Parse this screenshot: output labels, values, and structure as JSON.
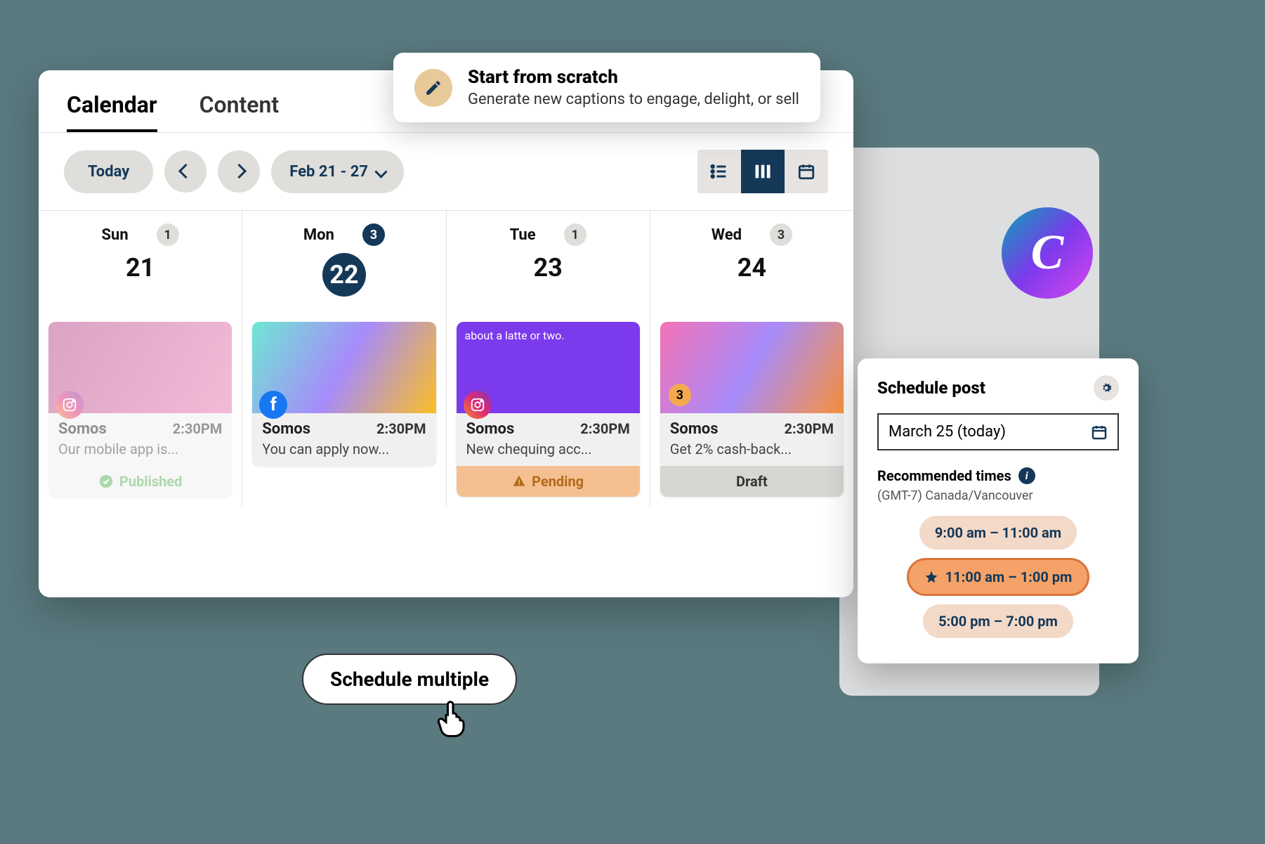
{
  "tabs": {
    "calendar": "Calendar",
    "content": "Content"
  },
  "toolbar": {
    "today": "Today",
    "range": "Feb 21 - 27"
  },
  "days": [
    {
      "name": "Sun",
      "num": "21",
      "count": "1",
      "highlight": false
    },
    {
      "name": "Mon",
      "num": "22",
      "count": "3",
      "highlight": true
    },
    {
      "name": "Tue",
      "num": "23",
      "count": "1",
      "highlight": false
    },
    {
      "name": "Wed",
      "num": "24",
      "count": "3",
      "highlight": false
    }
  ],
  "posts": [
    {
      "account": "Somos",
      "time": "2:30PM",
      "text": "Our mobile app is...",
      "status": "Published",
      "platform": "instagram"
    },
    {
      "account": "Somos",
      "time": "2:30PM",
      "text": "You can apply now...",
      "platform": "facebook"
    },
    {
      "account": "Somos",
      "time": "2:30PM",
      "text": "New chequing acc...",
      "status": "Pending",
      "platform": "instagram",
      "latte": "about a latte or two."
    },
    {
      "account": "Somos",
      "time": "2:30PM",
      "text": "Get 2% cash-back...",
      "status": "Draft",
      "count": "3"
    }
  ],
  "scratch": {
    "title": "Start from scratch",
    "subtitle": "Generate new captions to engage, delight, or sell"
  },
  "schedule_multiple": "Schedule multiple",
  "canva": "C",
  "schedule_panel": {
    "title": "Schedule post",
    "date": "March 25 (today)",
    "recommended": "Recommended times",
    "tz": "(GMT-7) Canada/Vancouver",
    "slots": [
      {
        "label": "9:00 am – 11:00 am",
        "best": false
      },
      {
        "label": "11:00 am – 1:00 pm",
        "best": true
      },
      {
        "label": "5:00 pm – 7:00 pm",
        "best": false
      }
    ]
  }
}
